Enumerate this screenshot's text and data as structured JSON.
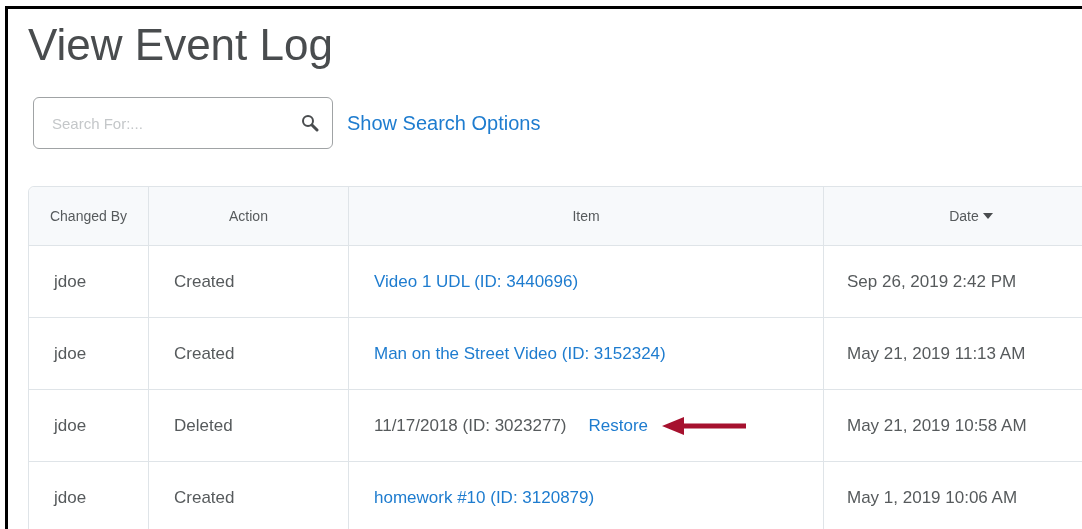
{
  "page": {
    "title": "View Event Log"
  },
  "search": {
    "placeholder": "Search For:..."
  },
  "search_options_link": "Show Search Options",
  "table": {
    "columns": [
      {
        "label": "Changed By",
        "sorted": false
      },
      {
        "label": "Action",
        "sorted": false
      },
      {
        "label": "Item",
        "sorted": false
      },
      {
        "label": "Date",
        "sorted": true
      }
    ],
    "rows": [
      {
        "changed_by": "jdoe",
        "action": "Created",
        "item": "Video 1 UDL (ID: 3440696)",
        "kind": "link",
        "date": "Sep 26, 2019 2:42 PM",
        "arrow": false
      },
      {
        "changed_by": "jdoe",
        "action": "Created",
        "item": "Man on the Street Video (ID: 3152324)",
        "kind": "link",
        "date": "May 21, 2019 11:13 AM",
        "arrow": false
      },
      {
        "changed_by": "jdoe",
        "action": "Deleted",
        "item": "11/17/2018 (ID: 3023277)",
        "kind": "deleted",
        "restore": "Restore",
        "date": "May 21, 2019 10:58 AM",
        "arrow": true
      },
      {
        "changed_by": "jdoe",
        "action": "Created",
        "item": "homework #10 (ID: 3120879)",
        "kind": "link",
        "date": "May 1, 2019 10:06 AM",
        "arrow": false
      }
    ]
  }
}
